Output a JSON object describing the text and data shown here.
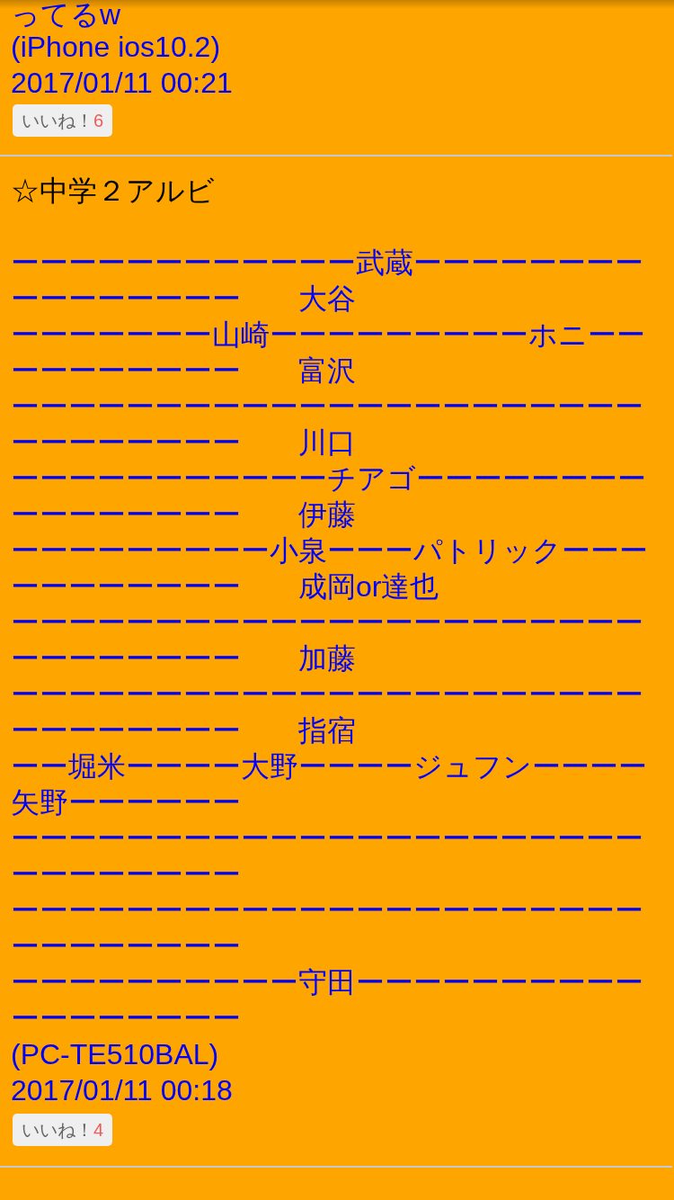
{
  "posts": [
    {
      "body_lines": [
        "ってるw"
      ],
      "device": "(iPhone ios10.2)",
      "date": "2017/01/11 00:21",
      "like": {
        "label": "いいね！",
        "count": "6"
      }
    },
    {
      "title": "☆中学２アルビ",
      "body_lines": [
        "ーーーーーーーーーーーー武蔵ーーーーーーーー",
        "ーーーーーーーー　　大谷",
        "ーーーーーーー山崎ーーーーーーーーーホニーー",
        "ーーーーーーーー　　富沢",
        "ーーーーーーーーーーーーーーーーーーーーーー",
        "ーーーーーーーー　　川口",
        "ーーーーーーーーーーーチアゴーーーーーーーー",
        "ーーーーーーーー　　伊藤",
        "ーーーーーーーーー小泉ーーーパトリックーーー",
        "ーーーーーーーー　　成岡or達也",
        "ーーーーーーーーーーーーーーーーーーーーーー",
        "ーーーーーーーー　　加藤",
        "ーーーーーーーーーーーーーーーーーーーーーー",
        "ーーーーーーーー　　指宿",
        "ーー堀米ーーーー大野ーーーージュフンーーーー",
        "矢野ーーーーーー",
        "ーーーーーーーーーーーーーーーーーーーーーー",
        "ーーーーーーーー",
        "ーーーーーーーーーーーーーーーーーーーーーー",
        "ーーーーーーーー",
        "ーーーーーーーーーー守田ーーーーーーーーーー",
        "ーーーーーーーー"
      ],
      "device": "(PC-TE510BAL)",
      "date": "2017/01/11 00:18",
      "like": {
        "label": "いいね！",
        "count": "4"
      }
    }
  ]
}
